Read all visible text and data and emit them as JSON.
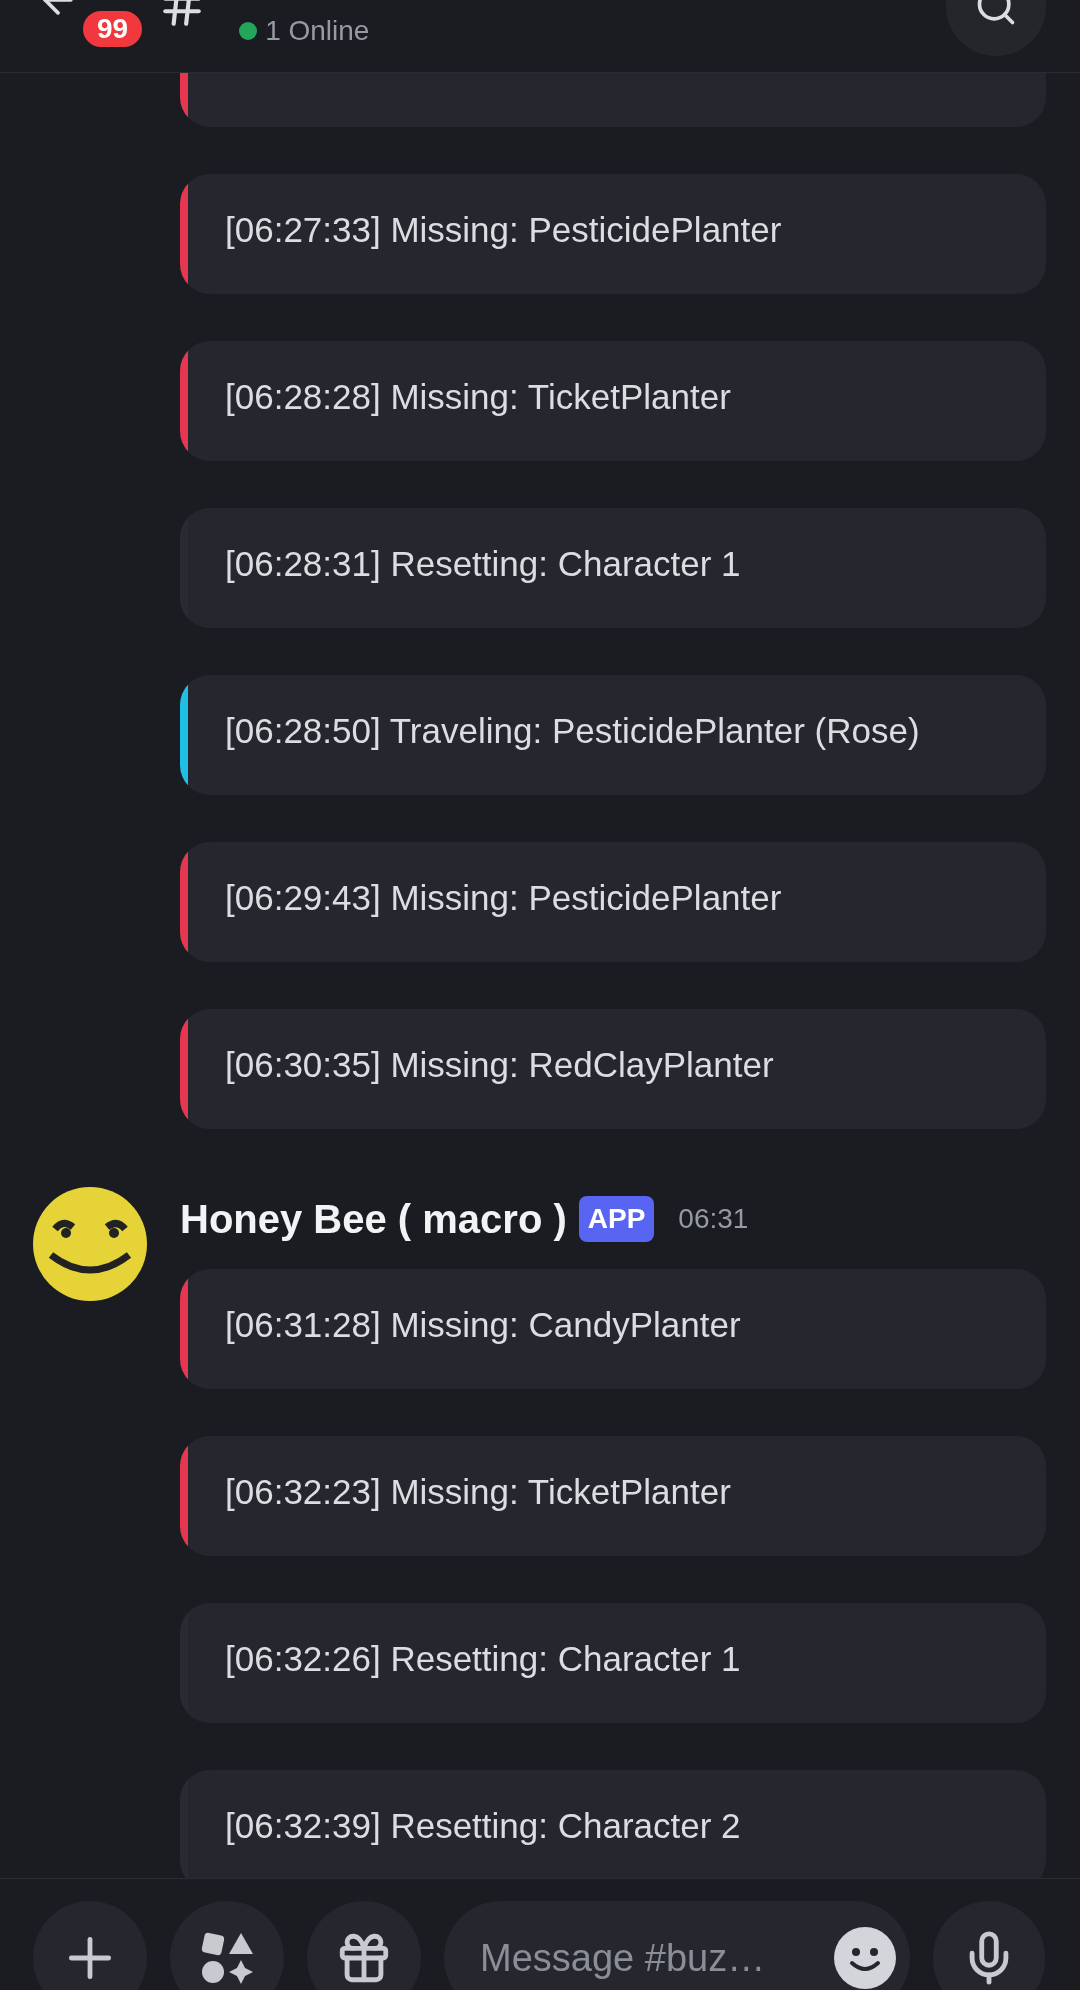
{
  "header": {
    "unread_badge": "99",
    "status": "1 Online"
  },
  "groups": [
    {
      "embeds": [
        {
          "kind": "partial",
          "color": "#e5374f"
        },
        {
          "kind": "full",
          "color": "#e5374f",
          "text": "[06:27:33] Missing: PesticidePlanter"
        },
        {
          "kind": "full",
          "color": "#e5374f",
          "text": "[06:28:28] Missing: TicketPlanter"
        },
        {
          "kind": "full",
          "color": "#2a2b32",
          "text": "[06:28:31] Resetting: Character 1"
        },
        {
          "kind": "full",
          "color": "#20bfe6",
          "text": "[06:28:50] Traveling: PesticidePlanter (Rose)"
        },
        {
          "kind": "full",
          "color": "#e5374f",
          "text": "[06:29:43] Missing: PesticidePlanter"
        },
        {
          "kind": "full",
          "color": "#e5374f",
          "text": "[06:30:35] Missing: RedClayPlanter"
        }
      ]
    },
    {
      "author": {
        "name": "Honey Bee ( macro )",
        "badge": "APP",
        "time": "06:31"
      },
      "embeds": [
        {
          "kind": "full",
          "color": "#e5374f",
          "text": "[06:31:28] Missing: CandyPlanter"
        },
        {
          "kind": "full",
          "color": "#e5374f",
          "text": "[06:32:23] Missing: TicketPlanter"
        },
        {
          "kind": "full",
          "color": "#2a2b32",
          "text": "[06:32:26] Resetting: Character 1"
        },
        {
          "kind": "full",
          "color": "#2a2b32",
          "text": "[06:32:39] Resetting: Character 2"
        }
      ]
    }
  ],
  "composer": {
    "placeholder": "Message #buz…"
  }
}
